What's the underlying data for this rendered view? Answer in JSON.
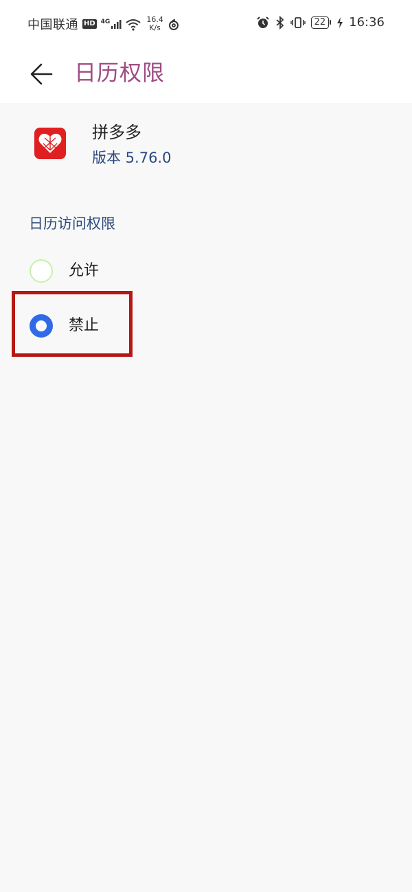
{
  "status_bar": {
    "carrier": "中国联通",
    "hd_badge": "HD",
    "network_type": "4G",
    "net_speed_value": "16.4",
    "net_speed_unit": "K/s",
    "battery": "22",
    "time": "16:36"
  },
  "header": {
    "title": "日历权限"
  },
  "app": {
    "name": "拼多多",
    "version": "版本 5.76.0",
    "icon_color": "#e02020"
  },
  "permission": {
    "section_title": "日历访问权限",
    "options": [
      {
        "label": "允许",
        "selected": false
      },
      {
        "label": "禁止",
        "selected": true
      }
    ]
  },
  "colors": {
    "title_accent": "#a04c84",
    "secondary_text": "#2c4a7e",
    "radio_selected": "#2f6be6",
    "highlight_border": "#b51812"
  }
}
